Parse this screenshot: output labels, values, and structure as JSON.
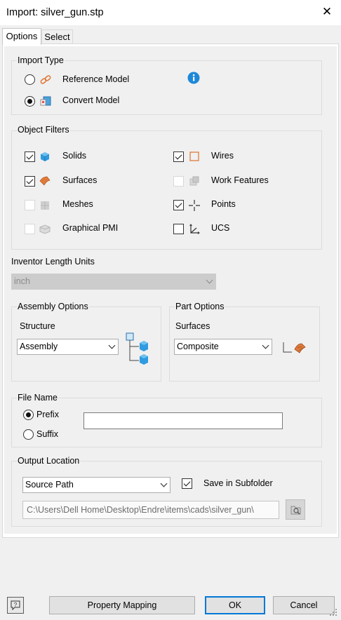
{
  "window": {
    "title": "Import:  silver_gun.stp",
    "close_glyph": "✕"
  },
  "tabs": [
    {
      "label": "Options",
      "active": true
    },
    {
      "label": "Select",
      "active": false
    }
  ],
  "import_type": {
    "legend": "Import Type",
    "options": [
      {
        "label": "Reference Model",
        "icon": "link-icon",
        "selected": false
      },
      {
        "label": "Convert Model",
        "icon": "convert-model-icon",
        "selected": true
      }
    ],
    "info_icon": "info-icon"
  },
  "object_filters": {
    "legend": "Object Filters",
    "items": [
      {
        "label": "Solids",
        "icon": "solid-cube-icon",
        "checked": true,
        "enabled": true
      },
      {
        "label": "Wires",
        "icon": "wire-square-icon",
        "checked": true,
        "enabled": true
      },
      {
        "label": "Surfaces",
        "icon": "surface-icon",
        "checked": true,
        "enabled": true
      },
      {
        "label": "Work Features",
        "icon": "work-features-icon",
        "checked": false,
        "enabled": false
      },
      {
        "label": "Meshes",
        "icon": "mesh-icon",
        "checked": false,
        "enabled": false
      },
      {
        "label": "Points",
        "icon": "point-crosshair-icon",
        "checked": true,
        "enabled": true
      },
      {
        "label": "Graphical PMI",
        "icon": "pmi-icon",
        "checked": false,
        "enabled": false
      },
      {
        "label": "UCS",
        "icon": "ucs-axes-icon",
        "checked": false,
        "enabled": true
      }
    ]
  },
  "length_units": {
    "label": "Inventor Length Units",
    "value": "inch",
    "enabled": false
  },
  "assembly_options": {
    "legend": "Assembly Options",
    "field_label": "Structure",
    "value": "Assembly",
    "icon": "assembly-tree-icon"
  },
  "part_options": {
    "legend": "Part Options",
    "field_label": "Surfaces",
    "value": "Composite",
    "icon": "composite-surface-icon"
  },
  "file_name": {
    "legend": "File Name",
    "options": [
      {
        "label": "Prefix",
        "selected": true
      },
      {
        "label": "Suffix",
        "selected": false
      }
    ],
    "value": ""
  },
  "output_location": {
    "legend": "Output Location",
    "value": "Source Path",
    "save_in_subfolder": {
      "label": "Save in Subfolder",
      "checked": true
    },
    "path": "C:\\Users\\Dell Home\\Desktop\\Endre\\items\\cads\\silver_gun\\",
    "browse_icon": "browse-folder-icon"
  },
  "footer": {
    "help_icon": "help-icon",
    "property_mapping_label": "Property Mapping",
    "ok_label": "OK",
    "cancel_label": "Cancel"
  },
  "colors": {
    "accent": "#0078d7",
    "info_blue": "#1e88d8",
    "cube_blue": "#2f9be0",
    "wire_orange": "#e07a3a"
  }
}
